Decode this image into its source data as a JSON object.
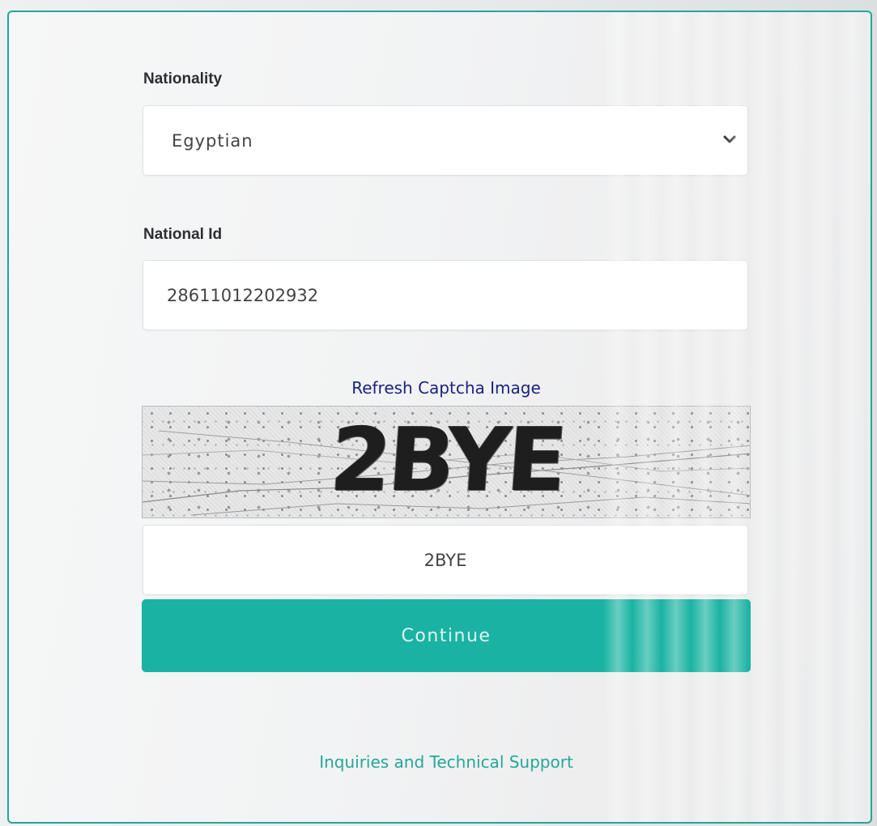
{
  "form": {
    "nationality": {
      "label": "Nationality",
      "selected": "Egyptian"
    },
    "national_id": {
      "label": "National Id",
      "value": "28611012202932"
    },
    "captcha": {
      "refresh_link": "Refresh Captcha Image",
      "image_text": "2BYE",
      "input_value": "2BYE"
    },
    "continue_label": "Continue",
    "support_link": "Inquiries and Technical Support"
  },
  "colors": {
    "accent": "#1ab3a3",
    "border": "#26a69a",
    "link": "#1a237e"
  }
}
